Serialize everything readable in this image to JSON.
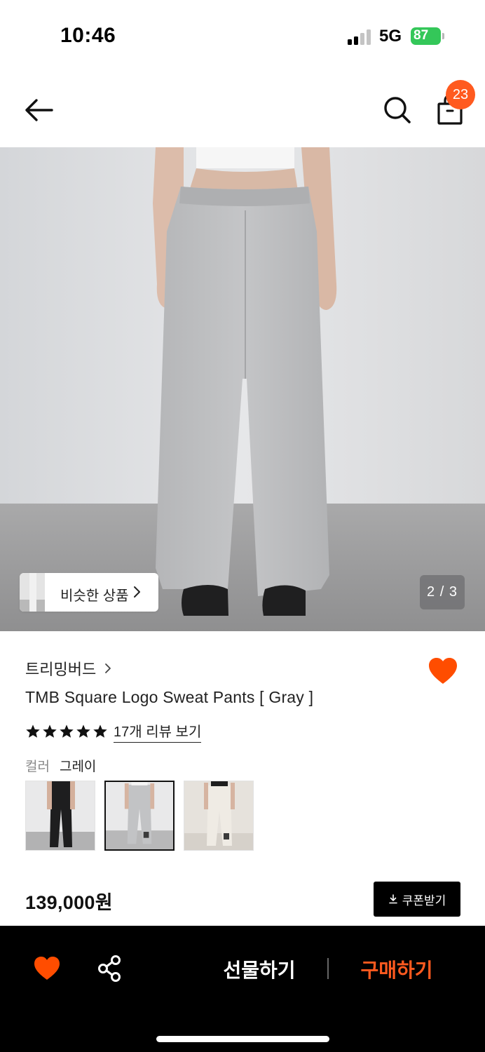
{
  "status_bar": {
    "time": "10:46",
    "network": "5G",
    "battery": "87"
  },
  "header": {
    "back_icon": "arrow-left-icon",
    "search_icon": "search-icon",
    "bag_icon": "shopping-bag-icon",
    "cart_count": "23"
  },
  "gallery": {
    "similar_label": "비슷한 상품",
    "counter": "2 / 3",
    "current_image": 2,
    "total_images": 3
  },
  "product": {
    "brand": "트리밍버드",
    "title": "TMB Square Logo Sweat Pants [ Gray ]",
    "rating_stars": 5,
    "review_link": "17개 리뷰 보기",
    "color_label": "컬러",
    "color_value": "그레이",
    "swatches": [
      {
        "name": "black"
      },
      {
        "name": "gray",
        "selected": true
      },
      {
        "name": "ivory"
      }
    ],
    "price": "139,000원",
    "coupon_label": "쿠폰받기"
  },
  "bottom_bar": {
    "gift_label": "선물하기",
    "buy_label": "구매하기"
  },
  "colors": {
    "accent": "#ff5a1f",
    "battery_green": "#34c759",
    "bottom_bar_bg": "#000000"
  }
}
